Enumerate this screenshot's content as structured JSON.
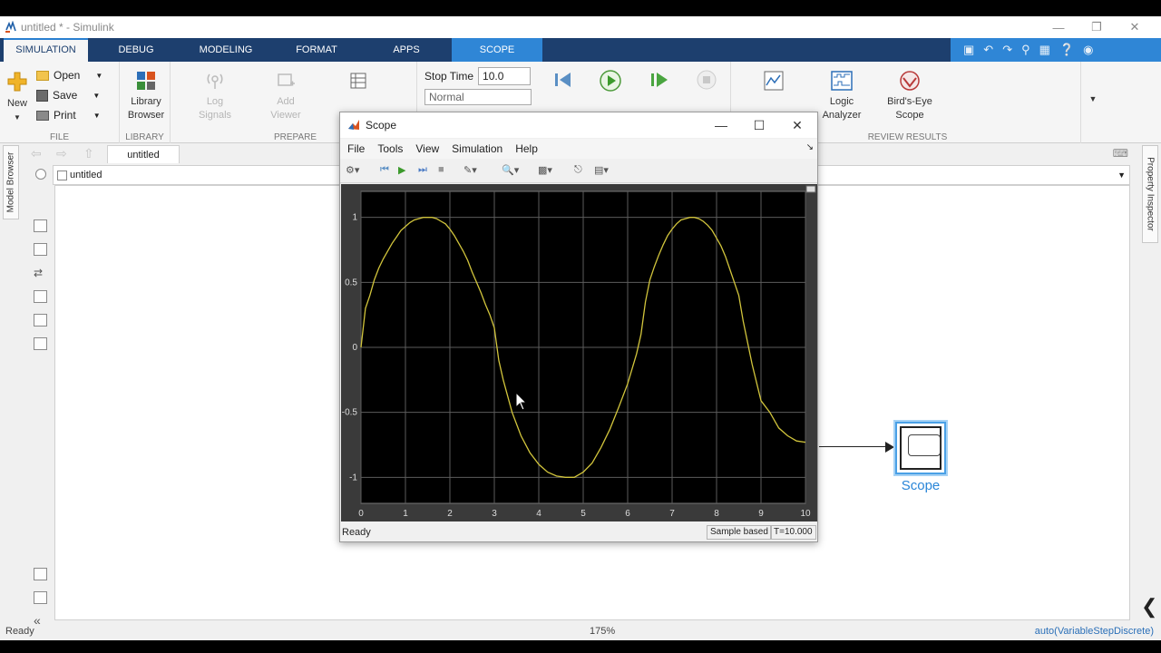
{
  "window": {
    "title": "untitled * - Simulink"
  },
  "ribbon_tabs": [
    "SIMULATION",
    "DEBUG",
    "MODELING",
    "FORMAT",
    "APPS",
    "SCOPE"
  ],
  "ribbon": {
    "file_group": {
      "label": "FILE",
      "new": "New",
      "open": "Open",
      "save": "Save",
      "print": "Print"
    },
    "library_group": {
      "label": "LIBRARY",
      "library_browser_line1": "Library",
      "library_browser_line2": "Browser"
    },
    "prepare_group": {
      "label": "PREPARE",
      "log_signals_line1": "Log",
      "log_signals_line2": "Signals",
      "add_viewer_line1": "Add",
      "add_viewer_line2": "Viewer"
    },
    "simulate_group": {
      "stop_time_label": "Stop Time",
      "stop_time_value": "10.0",
      "mode_value": "Normal"
    },
    "review_group": {
      "label": "REVIEW RESULTS",
      "logic_analyzer_line1": "Logic",
      "logic_analyzer_line2": "Analyzer",
      "birds_eye_line1": "Bird's-Eye",
      "birds_eye_line2": "Scope"
    }
  },
  "side_tabs": {
    "left": "Model Browser",
    "right": "Property Inspector"
  },
  "editor": {
    "tab_label": "untitled",
    "address": "untitled"
  },
  "scope_block": {
    "label": "Scope"
  },
  "statusbar": {
    "left": "Ready",
    "zoom": "175%",
    "solver": "auto(VariableStepDiscrete)"
  },
  "scope_window": {
    "title": "Scope",
    "menu": [
      "File",
      "Tools",
      "View",
      "Simulation",
      "Help"
    ],
    "status_left": "Ready",
    "status_mode": "Sample based",
    "status_time": "T=10.000"
  },
  "colors": {
    "ribbon_tab_bar": "#1d3f6e",
    "scope_tab": "#2f86d6",
    "plot_background": "#000000",
    "signal": "#d2c53c",
    "scope_label": "#2a86d8"
  },
  "chart_data": {
    "type": "line",
    "series": [
      {
        "x": [
          0,
          0.1,
          0.2,
          0.3,
          0.4,
          0.5,
          0.6,
          0.7,
          0.8,
          0.9,
          1.0,
          1.1,
          1.2,
          1.3,
          1.4,
          1.5,
          1.6,
          1.7,
          1.8,
          1.9,
          2.0,
          2.1,
          2.2,
          2.3,
          2.4,
          2.5,
          2.6,
          2.7,
          2.8,
          2.9,
          3.0,
          3.1,
          3.2,
          3.4,
          3.6,
          3.8,
          4.0,
          4.2,
          4.4,
          4.6,
          4.7,
          4.8,
          5.0,
          5.2,
          5.4,
          5.6,
          5.8,
          6.0,
          6.2,
          6.3,
          6.4,
          6.5,
          6.6,
          6.7,
          6.8,
          6.9,
          7.0,
          7.1,
          7.2,
          7.3,
          7.4,
          7.5,
          7.6,
          7.7,
          7.8,
          7.9,
          8.0,
          8.1,
          8.2,
          8.3,
          8.4,
          8.5,
          8.6,
          8.8,
          9.0,
          9.2,
          9.4,
          9.6,
          9.8,
          10.0
        ],
        "y": [
          0,
          0.3,
          0.4,
          0.52,
          0.61,
          0.68,
          0.74,
          0.8,
          0.85,
          0.9,
          0.93,
          0.96,
          0.98,
          0.99,
          1.0,
          1.0,
          1.0,
          0.99,
          0.97,
          0.95,
          0.91,
          0.86,
          0.8,
          0.74,
          0.67,
          0.58,
          0.5,
          0.42,
          0.33,
          0.25,
          0.15,
          -0.1,
          -0.25,
          -0.5,
          -0.68,
          -0.81,
          -0.9,
          -0.96,
          -0.99,
          -1.0,
          -1.0,
          -1.0,
          -0.96,
          -0.89,
          -0.77,
          -0.63,
          -0.46,
          -0.28,
          -0.05,
          0.1,
          0.35,
          0.52,
          0.62,
          0.71,
          0.79,
          0.86,
          0.91,
          0.95,
          0.98,
          0.99,
          1.0,
          1.0,
          0.99,
          0.97,
          0.94,
          0.9,
          0.84,
          0.78,
          0.7,
          0.6,
          0.5,
          0.4,
          0.2,
          -0.13,
          -0.41,
          -0.5,
          -0.62,
          -0.68,
          -0.72,
          -0.73
        ]
      }
    ],
    "xlim": [
      0,
      10
    ],
    "ylim": [
      -1.2,
      1.2
    ],
    "xticks": [
      0,
      1,
      2,
      3,
      4,
      5,
      6,
      7,
      8,
      9,
      10
    ],
    "yticks": [
      1,
      0.5,
      0,
      -0.5,
      -1
    ],
    "grid": true
  }
}
